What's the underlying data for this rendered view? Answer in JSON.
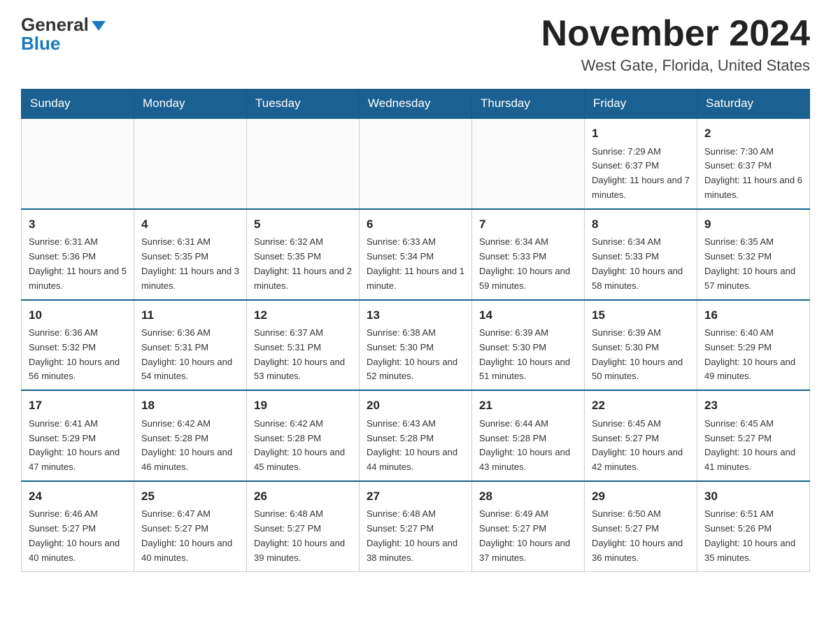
{
  "header": {
    "logo_general": "General",
    "logo_blue": "Blue",
    "month_title": "November 2024",
    "location": "West Gate, Florida, United States"
  },
  "days_of_week": [
    "Sunday",
    "Monday",
    "Tuesday",
    "Wednesday",
    "Thursday",
    "Friday",
    "Saturday"
  ],
  "weeks": [
    [
      {
        "day": "",
        "info": ""
      },
      {
        "day": "",
        "info": ""
      },
      {
        "day": "",
        "info": ""
      },
      {
        "day": "",
        "info": ""
      },
      {
        "day": "",
        "info": ""
      },
      {
        "day": "1",
        "info": "Sunrise: 7:29 AM\nSunset: 6:37 PM\nDaylight: 11 hours and 7 minutes."
      },
      {
        "day": "2",
        "info": "Sunrise: 7:30 AM\nSunset: 6:37 PM\nDaylight: 11 hours and 6 minutes."
      }
    ],
    [
      {
        "day": "3",
        "info": "Sunrise: 6:31 AM\nSunset: 5:36 PM\nDaylight: 11 hours and 5 minutes."
      },
      {
        "day": "4",
        "info": "Sunrise: 6:31 AM\nSunset: 5:35 PM\nDaylight: 11 hours and 3 minutes."
      },
      {
        "day": "5",
        "info": "Sunrise: 6:32 AM\nSunset: 5:35 PM\nDaylight: 11 hours and 2 minutes."
      },
      {
        "day": "6",
        "info": "Sunrise: 6:33 AM\nSunset: 5:34 PM\nDaylight: 11 hours and 1 minute."
      },
      {
        "day": "7",
        "info": "Sunrise: 6:34 AM\nSunset: 5:33 PM\nDaylight: 10 hours and 59 minutes."
      },
      {
        "day": "8",
        "info": "Sunrise: 6:34 AM\nSunset: 5:33 PM\nDaylight: 10 hours and 58 minutes."
      },
      {
        "day": "9",
        "info": "Sunrise: 6:35 AM\nSunset: 5:32 PM\nDaylight: 10 hours and 57 minutes."
      }
    ],
    [
      {
        "day": "10",
        "info": "Sunrise: 6:36 AM\nSunset: 5:32 PM\nDaylight: 10 hours and 56 minutes."
      },
      {
        "day": "11",
        "info": "Sunrise: 6:36 AM\nSunset: 5:31 PM\nDaylight: 10 hours and 54 minutes."
      },
      {
        "day": "12",
        "info": "Sunrise: 6:37 AM\nSunset: 5:31 PM\nDaylight: 10 hours and 53 minutes."
      },
      {
        "day": "13",
        "info": "Sunrise: 6:38 AM\nSunset: 5:30 PM\nDaylight: 10 hours and 52 minutes."
      },
      {
        "day": "14",
        "info": "Sunrise: 6:39 AM\nSunset: 5:30 PM\nDaylight: 10 hours and 51 minutes."
      },
      {
        "day": "15",
        "info": "Sunrise: 6:39 AM\nSunset: 5:30 PM\nDaylight: 10 hours and 50 minutes."
      },
      {
        "day": "16",
        "info": "Sunrise: 6:40 AM\nSunset: 5:29 PM\nDaylight: 10 hours and 49 minutes."
      }
    ],
    [
      {
        "day": "17",
        "info": "Sunrise: 6:41 AM\nSunset: 5:29 PM\nDaylight: 10 hours and 47 minutes."
      },
      {
        "day": "18",
        "info": "Sunrise: 6:42 AM\nSunset: 5:28 PM\nDaylight: 10 hours and 46 minutes."
      },
      {
        "day": "19",
        "info": "Sunrise: 6:42 AM\nSunset: 5:28 PM\nDaylight: 10 hours and 45 minutes."
      },
      {
        "day": "20",
        "info": "Sunrise: 6:43 AM\nSunset: 5:28 PM\nDaylight: 10 hours and 44 minutes."
      },
      {
        "day": "21",
        "info": "Sunrise: 6:44 AM\nSunset: 5:28 PM\nDaylight: 10 hours and 43 minutes."
      },
      {
        "day": "22",
        "info": "Sunrise: 6:45 AM\nSunset: 5:27 PM\nDaylight: 10 hours and 42 minutes."
      },
      {
        "day": "23",
        "info": "Sunrise: 6:45 AM\nSunset: 5:27 PM\nDaylight: 10 hours and 41 minutes."
      }
    ],
    [
      {
        "day": "24",
        "info": "Sunrise: 6:46 AM\nSunset: 5:27 PM\nDaylight: 10 hours and 40 minutes."
      },
      {
        "day": "25",
        "info": "Sunrise: 6:47 AM\nSunset: 5:27 PM\nDaylight: 10 hours and 40 minutes."
      },
      {
        "day": "26",
        "info": "Sunrise: 6:48 AM\nSunset: 5:27 PM\nDaylight: 10 hours and 39 minutes."
      },
      {
        "day": "27",
        "info": "Sunrise: 6:48 AM\nSunset: 5:27 PM\nDaylight: 10 hours and 38 minutes."
      },
      {
        "day": "28",
        "info": "Sunrise: 6:49 AM\nSunset: 5:27 PM\nDaylight: 10 hours and 37 minutes."
      },
      {
        "day": "29",
        "info": "Sunrise: 6:50 AM\nSunset: 5:27 PM\nDaylight: 10 hours and 36 minutes."
      },
      {
        "day": "30",
        "info": "Sunrise: 6:51 AM\nSunset: 5:26 PM\nDaylight: 10 hours and 35 minutes."
      }
    ]
  ]
}
